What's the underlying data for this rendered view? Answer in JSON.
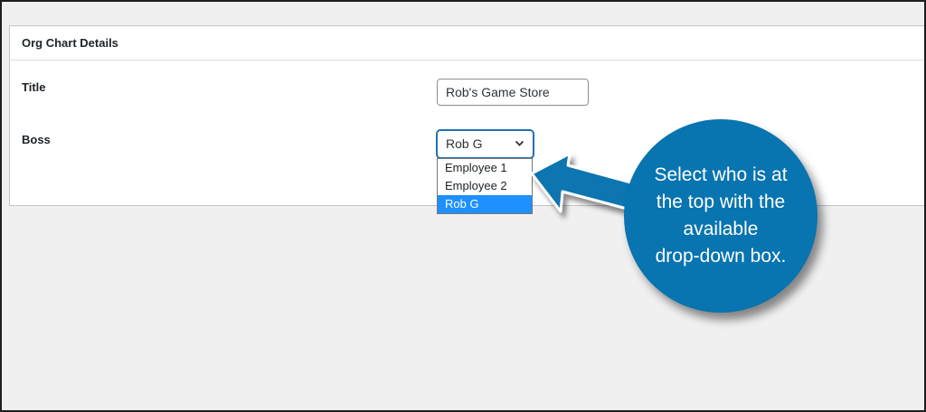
{
  "panel": {
    "title": "Org Chart Details"
  },
  "form": {
    "title_label": "Title",
    "title_value": "Rob's Game Store",
    "boss_label": "Boss",
    "boss_selected": "Rob G",
    "boss_options": [
      "Employee 1",
      "Employee 2",
      "Rob G"
    ]
  },
  "annotation": {
    "text": "Select who is at\nthe top with the\navailable\ndrop-down box.",
    "color": "#0874b0"
  },
  "icons": {
    "select_chevron": "chevron-down-icon",
    "arrow": "arrow-left-icon"
  }
}
